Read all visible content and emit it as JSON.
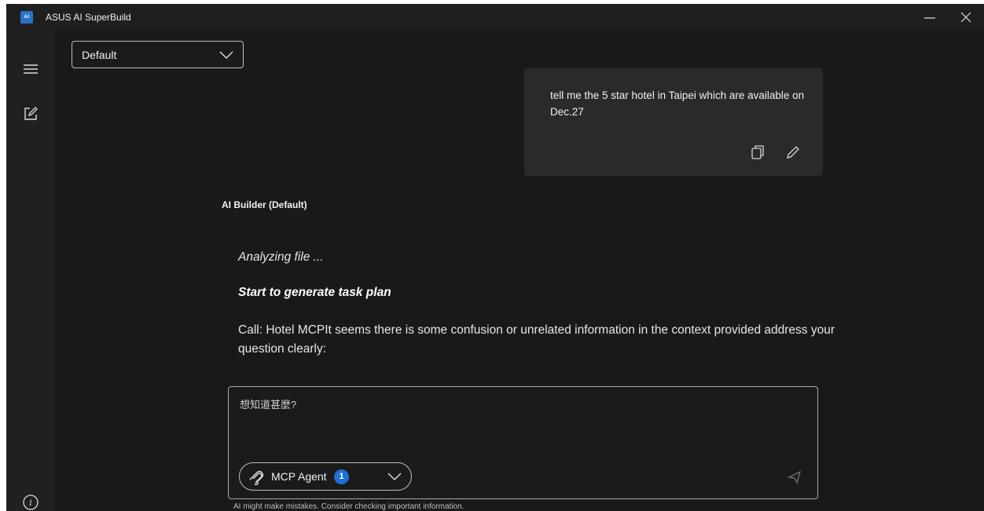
{
  "window": {
    "title": "ASUS AI SuperBuild",
    "icon_text": "AI",
    "minimize_icon": "minimize-icon",
    "close_icon": "close-icon"
  },
  "sidebar": {
    "menu_icon": "hamburger-menu-icon",
    "new_chat_icon": "new-chat-edit-icon",
    "info_icon": "info-icon"
  },
  "model_select": {
    "value": "Default"
  },
  "user_message": {
    "text": "tell me the 5 star hotel in Taipei which are available on Dec.27"
  },
  "ai_response": {
    "name": "AI Builder (Default)",
    "analyzing": "Analyzing file ...",
    "task_plan": "Start to generate task plan",
    "body": "Call: Hotel MCPIt seems there is some confusion or unrelated information in the context provided address your question clearly:"
  },
  "composer": {
    "placeholder": "想知道甚麼?",
    "agent_label": "MCP Agent",
    "agent_count": "1"
  },
  "disclaimer": "AI might make mistakes. Consider checking important information."
}
